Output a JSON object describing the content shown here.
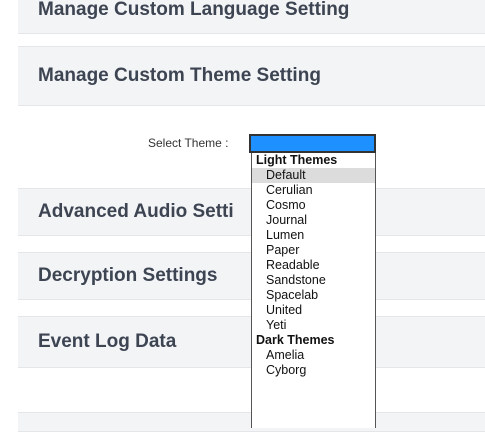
{
  "panels": {
    "language": "Manage Custom Language Setting",
    "theme": "Manage Custom Theme Setting",
    "audio": "Advanced Audio Setti",
    "decryption": "Decryption Settings",
    "event_log": "Event Log Data"
  },
  "theme_select": {
    "label": "Select Theme :",
    "groups": [
      {
        "label": "Light Themes",
        "options": [
          "Default",
          "Cerulian",
          "Cosmo",
          "Journal",
          "Lumen",
          "Paper",
          "Readable",
          "Sandstone",
          "Spacelab",
          "United",
          "Yeti"
        ]
      },
      {
        "label": "Dark Themes",
        "options": [
          "Amelia",
          "Cyborg"
        ]
      }
    ],
    "highlighted": "Default"
  },
  "colors": {
    "select_fill": "#1e90ff",
    "panel_bg": "#f3f4f6"
  }
}
